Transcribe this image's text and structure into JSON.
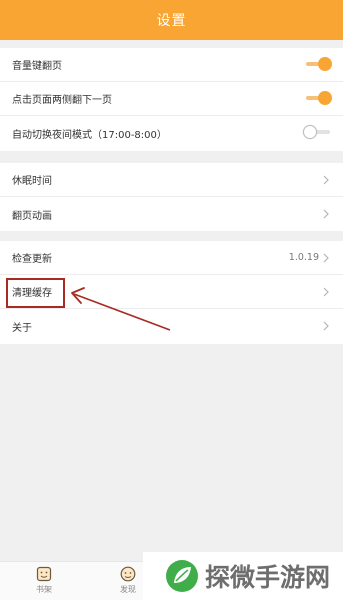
{
  "header": {
    "title": "设置"
  },
  "reading_settings": {
    "items": [
      {
        "label": "音量键翻页",
        "toggle": "on"
      },
      {
        "label": "点击页面两侧翻下一页",
        "toggle": "on"
      },
      {
        "label": "自动切换夜间模式（17:00-8:00）",
        "toggle": "off"
      }
    ]
  },
  "general_settings": {
    "items": [
      {
        "label": "休眠时间"
      },
      {
        "label": "翻页动画"
      }
    ]
  },
  "about_settings": {
    "items": [
      {
        "label": "检查更新",
        "value": "1.0.19"
      },
      {
        "label": "清理缓存"
      },
      {
        "label": "关于"
      }
    ]
  },
  "bottom_nav": {
    "tabs": [
      {
        "label": "书架",
        "icon": "bookshelf-icon"
      },
      {
        "label": "发现",
        "icon": "discover-icon"
      }
    ]
  },
  "watermark": {
    "text": "探微手游网"
  },
  "colors": {
    "accent": "#f8a534",
    "annotation": "#a92a23",
    "background": "#f0f0f0"
  }
}
